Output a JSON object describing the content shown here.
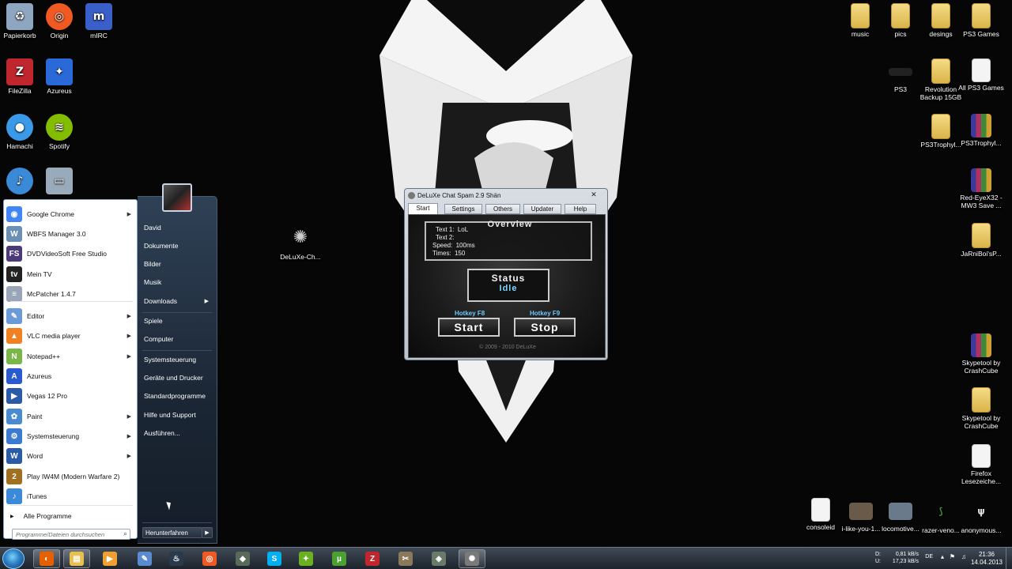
{
  "desktop": {
    "left_icons": [
      {
        "label": "Papierkorb",
        "icon": "recycle-bin-icon",
        "color": "#8ea6bf"
      },
      {
        "label": "Origin",
        "icon": "origin-icon",
        "color": "#f05a22"
      },
      {
        "label": "mIRC",
        "icon": "mirc-icon",
        "color": "#3a5fc8"
      },
      {
        "label": "FileZilla",
        "icon": "filezilla-icon",
        "color": "#c0262d"
      },
      {
        "label": "Azureus",
        "icon": "azureus-frog-icon",
        "color": "#2a6ad8"
      },
      {
        "label": "Hamachi",
        "icon": "hamachi-icon",
        "color": "#3a9ae8"
      },
      {
        "label": "Spotify",
        "icon": "spotify-icon",
        "color": "#84bd00"
      }
    ],
    "center_icon": {
      "label": "DeLuXe-Ch...",
      "icon": "deluxe-chat-icon"
    },
    "right_icons": [
      {
        "label": "music",
        "type": "folder"
      },
      {
        "label": "pics",
        "type": "folder"
      },
      {
        "label": "desings",
        "type": "folder"
      },
      {
        "label": "PS3 Games",
        "type": "folder"
      },
      {
        "label": "PS3",
        "type": "device"
      },
      {
        "label": "Revolution Backup 15GB",
        "type": "folder"
      },
      {
        "label": "All PS3 Games",
        "type": "file"
      },
      {
        "label": "PS3Trophyl...",
        "type": "folder"
      },
      {
        "label": "PS3Trophyl...",
        "type": "rar"
      },
      {
        "label": "Red-EyeX32 - MW3 Save ...",
        "type": "rar"
      },
      {
        "label": "JaRniBoi'sP...",
        "type": "folder"
      },
      {
        "label": "Skypetool by CrashCube",
        "type": "rar"
      },
      {
        "label": "Skypetool by CrashCube",
        "type": "folder"
      },
      {
        "label": "Firefox Lesezeiche...",
        "type": "file"
      },
      {
        "label": "consoleid",
        "type": "file"
      },
      {
        "label": "i-like-you-1...",
        "type": "image"
      },
      {
        "label": "locomotive...",
        "type": "image"
      },
      {
        "label": "razer-veno...",
        "type": "image"
      },
      {
        "label": "anonymous...",
        "type": "image"
      }
    ]
  },
  "start_menu": {
    "programs": [
      {
        "label": "Google Chrome",
        "icon": "chrome-icon",
        "color": "#4285f4",
        "glyph": "◉",
        "has_arrow": true
      },
      {
        "label": "WBFS Manager 3.0",
        "icon": "wbfs-icon",
        "color": "#6a8fb5",
        "glyph": "W",
        "has_arrow": false
      },
      {
        "label": "DVDVideoSoft Free Studio",
        "icon": "dvdvideosoft-icon",
        "color": "#4a3a7a",
        "glyph": "FS",
        "has_arrow": false
      },
      {
        "label": "Mein TV",
        "icon": "tv-icon",
        "color": "#222222",
        "glyph": "tv",
        "has_arrow": false
      },
      {
        "label": "McPatcher 1.4.7",
        "icon": "mcpatcher-icon",
        "color": "#9aa6b8",
        "glyph": "≡",
        "has_arrow": false
      },
      {
        "label": "Editor",
        "icon": "notepad-icon",
        "color": "#6a9ad8",
        "glyph": "✎",
        "has_arrow": true
      },
      {
        "label": "VLC media player",
        "icon": "vlc-icon",
        "color": "#f08020",
        "glyph": "▲",
        "has_arrow": true
      },
      {
        "label": "Notepad++",
        "icon": "notepadpp-icon",
        "color": "#7ab648",
        "glyph": "N",
        "has_arrow": true
      },
      {
        "label": "Azureus",
        "icon": "azureus-icon",
        "color": "#2a5ad0",
        "glyph": "A",
        "has_arrow": false
      },
      {
        "label": "Vegas 12 Pro",
        "icon": "vegas-icon",
        "color": "#2a5aa8",
        "glyph": "▶",
        "has_arrow": false
      },
      {
        "label": "Paint",
        "icon": "paint-icon",
        "color": "#4a8ad0",
        "glyph": "✿",
        "has_arrow": true
      },
      {
        "label": "Systemsteuerung",
        "icon": "control-panel-icon",
        "color": "#3a7ad0",
        "glyph": "⚙",
        "has_arrow": true
      },
      {
        "label": "Word",
        "icon": "word-icon",
        "color": "#2a5aa8",
        "glyph": "W",
        "has_arrow": true
      },
      {
        "label": "Play IW4M (Modern Warfare 2)",
        "icon": "iw4m-icon",
        "color": "#a07020",
        "glyph": "2",
        "has_arrow": false
      },
      {
        "label": "iTunes",
        "icon": "itunes-icon",
        "color": "#3a8ad8",
        "glyph": "♪",
        "has_arrow": false
      }
    ],
    "all_programs": "Alle Programme",
    "search_placeholder": "Programme/Dateien durchsuchen",
    "right_items": [
      {
        "label": "David",
        "has_arrow": false
      },
      {
        "label": "Dokumente",
        "has_arrow": false
      },
      {
        "label": "Bilder",
        "has_arrow": false
      },
      {
        "label": "Musik",
        "has_arrow": false
      },
      {
        "label": "Downloads",
        "has_arrow": true
      },
      {
        "label": "Spiele",
        "has_arrow": false
      },
      {
        "label": "Computer",
        "has_arrow": false
      },
      {
        "label": "Systemsteuerung",
        "has_arrow": false
      },
      {
        "label": "Geräte und Drucker",
        "has_arrow": false
      },
      {
        "label": "Standardprogramme",
        "has_arrow": false
      },
      {
        "label": "Hilfe und Support",
        "has_arrow": false
      },
      {
        "label": "Ausführen...",
        "has_arrow": false
      }
    ],
    "shutdown_label": "Herunterfahren"
  },
  "app": {
    "title": "DeLuXe Chat Spam 2.9 Shän",
    "close": "✕",
    "tabs": [
      "Start",
      "Settings",
      "Others",
      "Updater",
      "Help"
    ],
    "active_tab": "Start",
    "overview": {
      "title": "Overview",
      "text1_label": "Text 1:",
      "text1_value": "LoL",
      "text2_label": "Text 2:",
      "text2_value": "",
      "speed_label": "Speed:",
      "speed_value": "100ms",
      "times_label": "Times:",
      "times_value": "150"
    },
    "status_label": "Status",
    "status_value": "Idle",
    "hotkey_start": "Hotkey F8",
    "hotkey_stop": "Hotkey F9",
    "start_button": "Start",
    "stop_button": "Stop",
    "copyright": "© 2009 - 2010 DeLuXe"
  },
  "taskbar": {
    "apps": [
      {
        "icon": "firefox-icon",
        "color": "#e66000",
        "glyph": "◐",
        "active": true
      },
      {
        "icon": "explorer-icon",
        "color": "#e8c050",
        "glyph": "▤",
        "active": true
      },
      {
        "icon": "media-player-icon",
        "color": "#f0a030",
        "glyph": "▶",
        "active": false
      },
      {
        "icon": "editor-icon",
        "color": "#5a8ad0",
        "glyph": "✎",
        "active": false
      },
      {
        "icon": "steam-icon",
        "color": "#2a3a4a",
        "glyph": "♨",
        "active": false
      },
      {
        "icon": "origin-icon",
        "color": "#f05a22",
        "glyph": "◎",
        "active": false
      },
      {
        "icon": "app-icon",
        "color": "#5a6a5a",
        "glyph": "◆",
        "active": false
      },
      {
        "icon": "skype-icon",
        "color": "#00aff0",
        "glyph": "S",
        "active": false
      },
      {
        "icon": "azureus-icon",
        "color": "#6ab020",
        "glyph": "✦",
        "active": false
      },
      {
        "icon": "utorrent-icon",
        "color": "#4aa030",
        "glyph": "µ",
        "active": false
      },
      {
        "icon": "filezilla-icon",
        "color": "#c0262d",
        "glyph": "Z",
        "active": false
      },
      {
        "icon": "tool-icon",
        "color": "#8a7a5a",
        "glyph": "✂",
        "active": false
      },
      {
        "icon": "app2-icon",
        "color": "#6a7a6a",
        "glyph": "◈",
        "active": false
      },
      {
        "icon": "deluxe-chat-icon",
        "color": "#7a7a7a",
        "glyph": "✺",
        "active": true
      }
    ],
    "tray_speed_1": "0,81 kB/s",
    "tray_speed_2": "17,23 kB/s",
    "tray_d": "D:",
    "tray_u": "U:",
    "language": "DE",
    "time": "21:36",
    "date": "14.04.2013"
  }
}
